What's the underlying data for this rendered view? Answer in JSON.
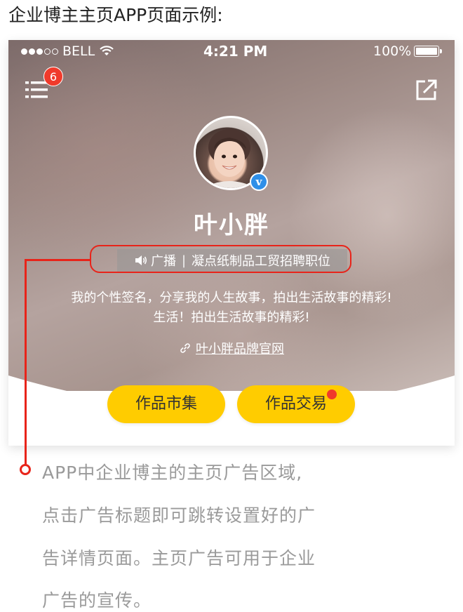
{
  "page": {
    "heading": "企业博主主页APP页面示例:"
  },
  "status_bar": {
    "carrier": "BELL",
    "time": "4:21 PM",
    "battery": "100%",
    "signal_full": 3,
    "signal_total": 5
  },
  "header": {
    "notification_count": "6"
  },
  "profile": {
    "name": "叶小胖",
    "verified_mark": "v",
    "ad_tag": "广播",
    "ad_separator": "|",
    "ad_title": "凝点纸制品工贸招聘职位",
    "bio_line1": "我的个性签名，分享我的人生故事，拍出生活故事的精彩!",
    "bio_line2": "生活！拍出生活故事的精彩!",
    "website_label": "叶小胖品牌官网"
  },
  "actions": {
    "works_market": "作品市集",
    "works_trade": "作品交易"
  },
  "caption": {
    "lines": [
      "APP中企业博主的主页广告区域,",
      "点击广告标题即可跳转设置好的广",
      "告详情页面。主页广告可用于企业",
      "广告的宣传。"
    ]
  },
  "colors": {
    "accent_yellow": "#ffcc00",
    "annotation_red": "#e8241a",
    "badge_red": "#f03a2b",
    "verified_blue": "#2f8fe8",
    "caption_gray": "#9a9a9a"
  },
  "icons": {
    "menu": "menu-icon",
    "share": "share-icon",
    "speaker": "speaker-icon",
    "link": "link-icon",
    "wifi": "wifi-icon",
    "battery": "battery-icon"
  }
}
